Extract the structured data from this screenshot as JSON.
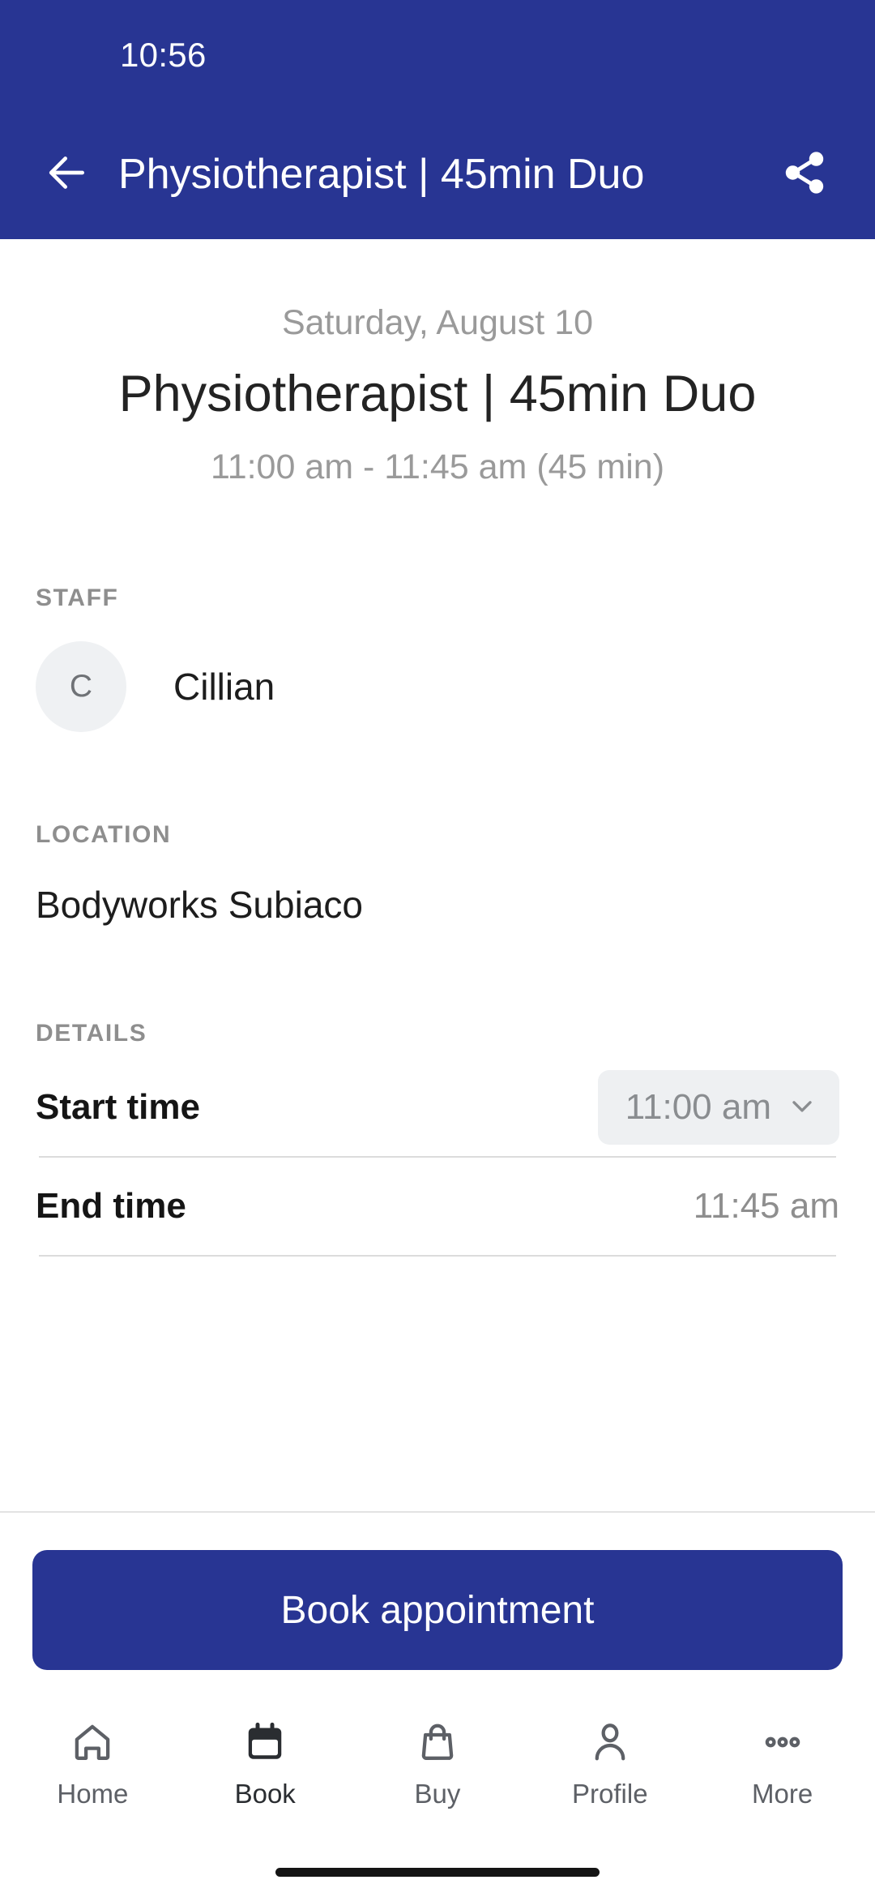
{
  "status_bar": {
    "clock": "10:56"
  },
  "app_bar": {
    "back_icon": "arrow-left-icon",
    "title": "Physiotherapist | 45min Duo",
    "share_icon": "share-icon"
  },
  "hero": {
    "date": "Saturday, August 10",
    "title": "Physiotherapist | 45min Duo",
    "time_range": "11:00 am - 11:45 am (45 min)"
  },
  "staff": {
    "label": "STAFF",
    "avatar_initial": "C",
    "name": "Cillian"
  },
  "location": {
    "label": "LOCATION",
    "value": "Bodyworks Subiaco"
  },
  "details": {
    "label": "DETAILS",
    "rows": [
      {
        "label": "Start time",
        "value": "11:00 am",
        "type": "dropdown",
        "chevron_icon": "chevron-down-icon"
      },
      {
        "label": "End time",
        "value": "11:45 am",
        "type": "text"
      }
    ]
  },
  "cta": {
    "label": "Book appointment"
  },
  "bottom_nav": {
    "items": [
      {
        "label": "Home",
        "icon": "home-icon",
        "active": false
      },
      {
        "label": "Book",
        "icon": "calendar-icon",
        "active": true
      },
      {
        "label": "Buy",
        "icon": "shopping-bag-icon",
        "active": false
      },
      {
        "label": "Profile",
        "icon": "person-icon",
        "active": false
      },
      {
        "label": "More",
        "icon": "ellipsis-icon",
        "active": false
      }
    ]
  },
  "colors": {
    "brand_blue": "#283593",
    "muted_text": "#9a9a9a",
    "body_text": "#1d1d1d",
    "field_bg": "#eef0f2",
    "divider": "#dcdcdc"
  }
}
